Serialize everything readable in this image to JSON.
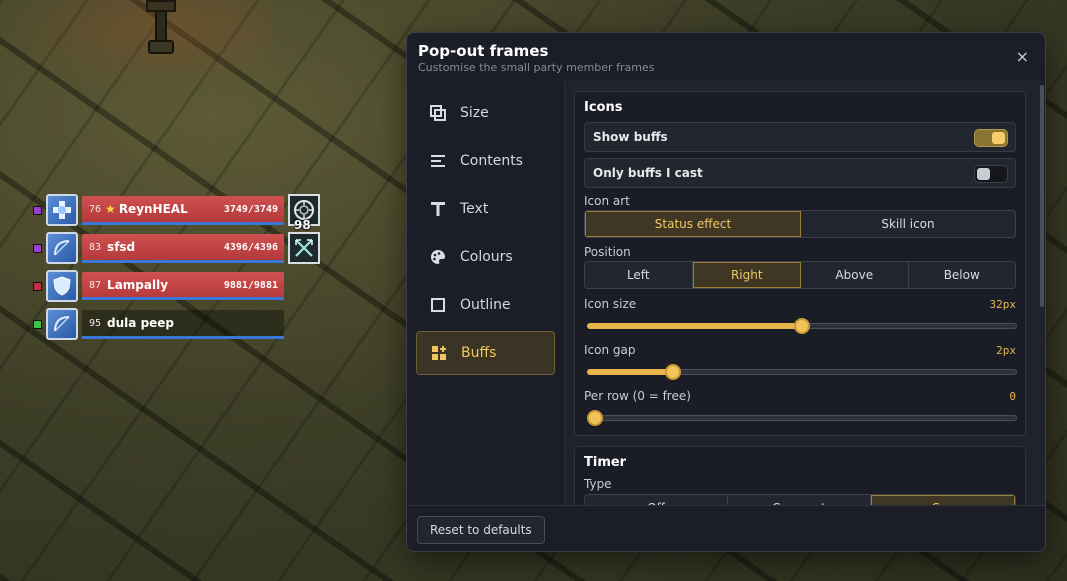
{
  "party": [
    {
      "level": "76",
      "name": "ReynHEAL",
      "star": "★",
      "hp": "3749/3749",
      "square_color": "#9a3fd0",
      "buff": {
        "icon": "compass-rune-icon",
        "count": "98"
      }
    },
    {
      "level": "83",
      "name": "sfsd",
      "star": "",
      "hp": "4396/4396",
      "square_color": "#9a3fd0",
      "buff": {
        "icon": "crossed-arrows-icon",
        "count": ""
      }
    },
    {
      "level": "87",
      "name": "Lampally",
      "star": "",
      "hp": "9881/9881",
      "square_color": "#c0304a",
      "buff": null
    },
    {
      "level": "95",
      "name": "dula peep",
      "star": "",
      "hp": "",
      "square_color": "#3fbf4a",
      "buff": null
    }
  ],
  "dialog": {
    "title": "Pop-out frames",
    "subtitle": "Customise the small party member frames",
    "close": "×",
    "reset": "Reset to defaults"
  },
  "sidebar": [
    {
      "label": "Size",
      "icon": "size-icon",
      "active": false
    },
    {
      "label": "Contents",
      "icon": "contents-icon",
      "active": false
    },
    {
      "label": "Text",
      "icon": "text-icon",
      "active": false
    },
    {
      "label": "Colours",
      "icon": "palette-icon",
      "active": false
    },
    {
      "label": "Outline",
      "icon": "outline-icon",
      "active": false
    },
    {
      "label": "Buffs",
      "icon": "buffs-grid-icon",
      "active": true
    }
  ],
  "icons_section": {
    "title": "Icons",
    "show_buffs": {
      "label": "Show buffs",
      "on": true
    },
    "only_mine": {
      "label": "Only buffs I cast",
      "on": false
    },
    "icon_art": {
      "label": "Icon art",
      "options": [
        "Status effect",
        "Skill icon"
      ],
      "selected": "Status effect"
    },
    "position": {
      "label": "Position",
      "options": [
        "Left",
        "Right",
        "Above",
        "Below"
      ],
      "selected": "Right"
    },
    "icon_size": {
      "label": "Icon size",
      "value_text": "32px",
      "fraction": 0.5
    },
    "icon_gap": {
      "label": "Icon gap",
      "value_text": "2px",
      "fraction": 0.2
    },
    "per_row": {
      "label": "Per row (0 = free)",
      "value_text": "0",
      "fraction": 0.0
    }
  },
  "timer_section": {
    "title": "Timer",
    "type_label": "Type",
    "options": [
      "Off",
      "Compact",
      "Sec"
    ],
    "selected": "Sec"
  },
  "colors": {
    "accent": "#f2c761",
    "dialog_bg": "#1b1e26",
    "hp_red": "#c04444",
    "mp_blue": "#3a78d8"
  }
}
